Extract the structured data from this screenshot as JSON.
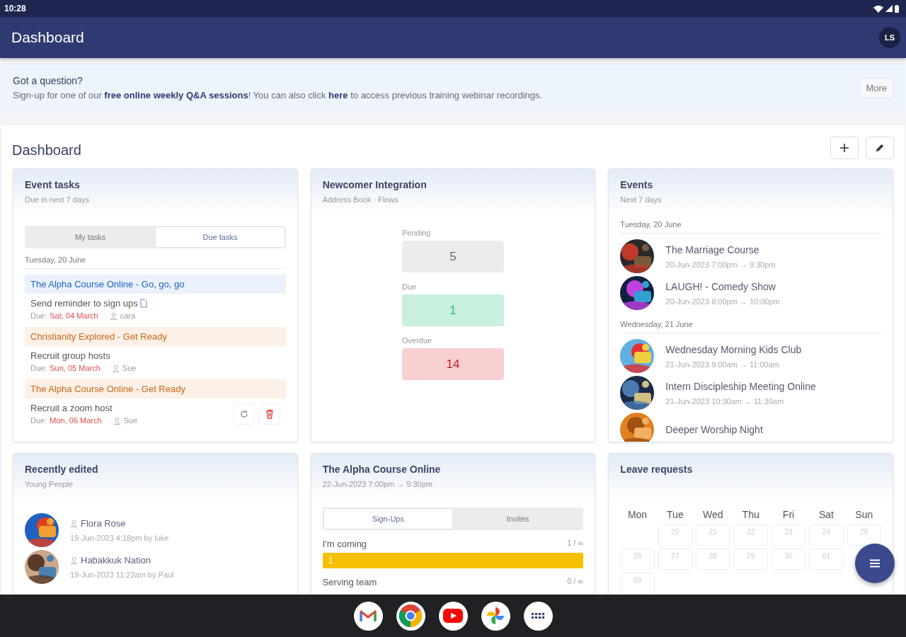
{
  "status_bar": {
    "time": "10:28"
  },
  "app_bar": {
    "title": "Dashboard",
    "avatar": "LS"
  },
  "banner": {
    "title": "Got a question?",
    "message": [
      {
        "kind": "text",
        "text": "Sign-up for one of our "
      },
      {
        "kind": "link",
        "text": "free online weekly Q&A sessions"
      },
      {
        "kind": "text",
        "text": "! You can also click "
      },
      {
        "kind": "link",
        "text": "here"
      },
      {
        "kind": "text",
        "text": " to access previous training webinar recordings."
      }
    ],
    "button": "More"
  },
  "dashboard": {
    "title": "Dashboard",
    "widgets": [
      {
        "kind": "tasks",
        "title": "Event tasks",
        "subtitle": "Due in next 7 days",
        "tabs": [
          {
            "label": "My tasks",
            "selected": false
          },
          {
            "label": "Due tasks",
            "selected": true
          }
        ],
        "date": "Tuesday, 20 June",
        "groups": [
          {
            "event": "The Alpha Course Online - Go, go, go",
            "color": "#eaf1fb",
            "tasks": [
              {
                "name": "Send reminder to sign ups",
                "attachment": true,
                "due_label": "Due:",
                "due": "Sat, 04 March",
                "assignee": "cara",
                "actions": false
              }
            ]
          },
          {
            "event": "Christianity Explored - Get Ready",
            "color": "#fdf0e6",
            "tasks": [
              {
                "name": "Recruit group hosts",
                "attachment": false,
                "due_label": "Due:",
                "due": "Sun, 05 March",
                "assignee": "Sue",
                "actions": false
              }
            ]
          },
          {
            "event": "The Alpha Course Online - Get Ready",
            "color": "#fdf0e6",
            "tasks": [
              {
                "name": "Recruit a zoom host",
                "attachment": false,
                "due_label": "Due:",
                "due": "Mon, 06 March",
                "assignee": "Sue",
                "actions": true
              }
            ]
          }
        ]
      },
      {
        "kind": "flows",
        "title": "Newcomer Integration",
        "subtitle": "Address Book · Flows",
        "counters": [
          {
            "label": "Pending",
            "value": "5",
            "color": "#ebeaed"
          },
          {
            "label": "Due",
            "value": "1",
            "color": "#c8f0dc"
          },
          {
            "label": "Overdue",
            "value": "14",
            "color": "#f8d0d2"
          }
        ]
      },
      {
        "kind": "events",
        "title": "Events",
        "subtitle": "Next 7 days",
        "days": [
          {
            "date": "Tuesday, 20 June",
            "events": [
              {
                "name": "The Marriage Course",
                "time": "20-Jun-2023 7:00pm → 9:30pm"
              },
              {
                "name": "LAUGH! - Comedy Show",
                "time": "20-Jun-2023 8:00pm → 10:00pm"
              }
            ]
          },
          {
            "date": "Wednesday, 21 June",
            "events": [
              {
                "name": "Wednesday Morning Kids Club",
                "time": "21-Jun-2023 9:00am → 11:00am"
              },
              {
                "name": "Intern Discipleship Meeting Online",
                "time": "21-Jun-2023 10:30am → 11:30am"
              },
              {
                "name": "Deeper Worship Night"
              }
            ]
          }
        ]
      },
      {
        "kind": "recent",
        "title": "Recently edited",
        "subtitle": "Young People",
        "items": [
          {
            "name": "Flora Rose",
            "meta": "19-Jun-2023 4:18pm by luke"
          },
          {
            "name": "Habakkuk Nation",
            "meta": "19-Jun-2023 11:22am by Paul"
          }
        ]
      },
      {
        "kind": "signups",
        "title": "The Alpha Course Online",
        "subtitle": "22-Jun-2023 7:00pm → 9:30pm",
        "tabs": [
          {
            "label": "Sign-Ups",
            "selected": true
          },
          {
            "label": "Invites",
            "selected": false
          }
        ],
        "rows": [
          {
            "label": "I'm coming",
            "reading": "1 / ∞",
            "count": "1",
            "level": 1
          },
          {
            "label": "Serving team",
            "reading": "0 / ∞"
          }
        ]
      },
      {
        "kind": "calendar",
        "title": "Leave requests",
        "weekdays": [
          "Mon",
          "Tue",
          "Wed",
          "Thu",
          "Fri",
          "Sat",
          "Sun"
        ],
        "weeks": [
          [
            {
              "kind": "blank"
            },
            {
              "kind": "day",
              "day": "20"
            },
            {
              "kind": "day",
              "day": "21"
            },
            {
              "kind": "day",
              "day": "22"
            },
            {
              "kind": "day",
              "day": "23"
            },
            {
              "kind": "day",
              "day": "24"
            },
            {
              "kind": "day",
              "day": "25"
            }
          ],
          [
            {
              "kind": "day",
              "day": "26"
            },
            {
              "kind": "day",
              "day": "27"
            },
            {
              "kind": "day",
              "day": "28"
            },
            {
              "kind": "day",
              "day": "29"
            },
            {
              "kind": "day",
              "day": "30"
            },
            {
              "kind": "day",
              "day": "01"
            },
            {
              "kind": "blank"
            }
          ],
          [
            {
              "kind": "day",
              "day": "03"
            }
          ]
        ]
      }
    ]
  }
}
